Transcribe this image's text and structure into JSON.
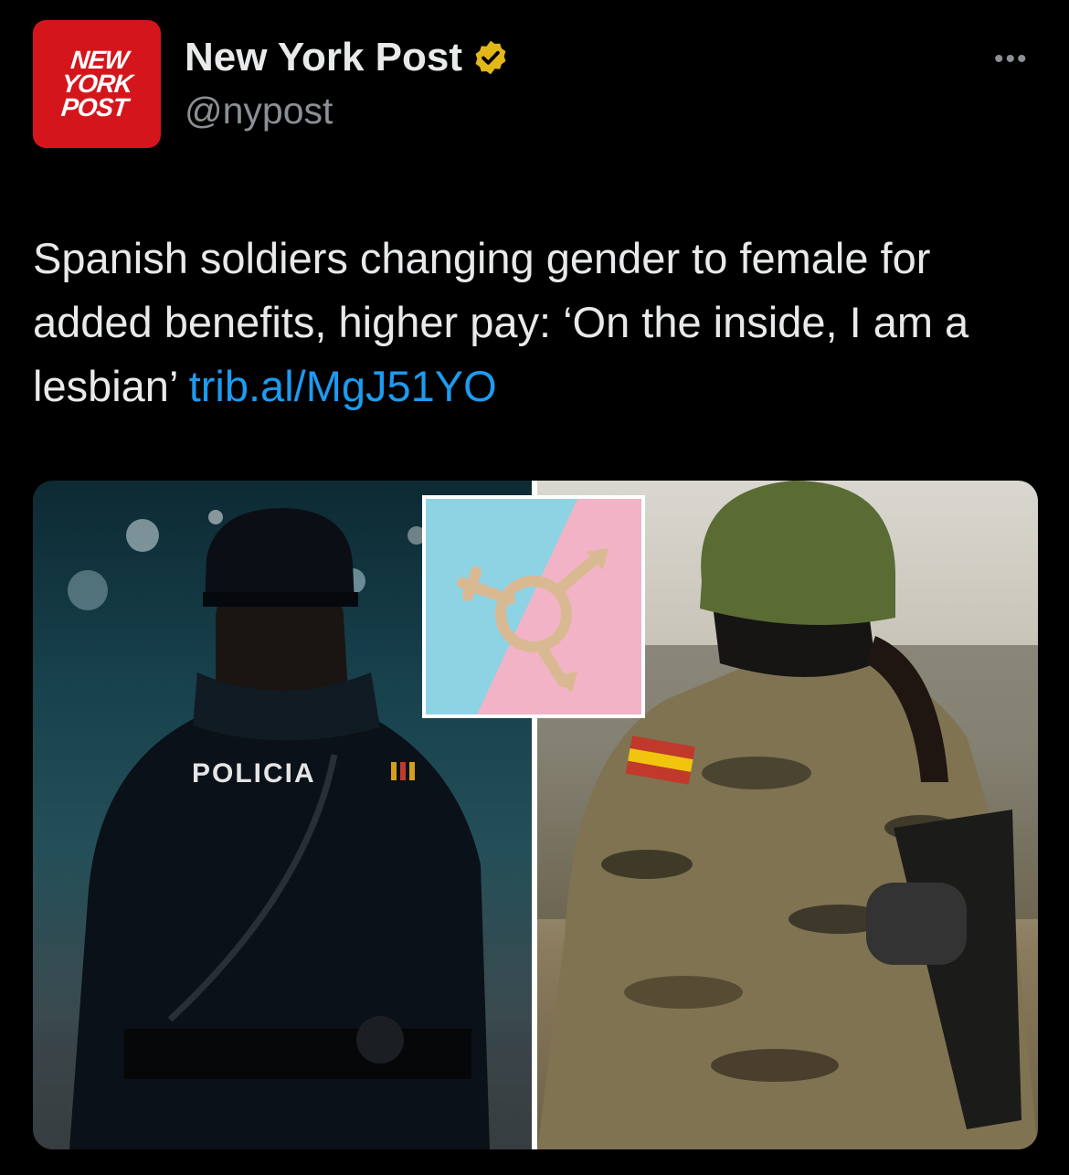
{
  "author": {
    "name": "New York Post",
    "handle": "@nypost",
    "avatar_text": [
      "NEW",
      "YORK",
      "POST"
    ],
    "verified": true,
    "verified_color": "#e2b719"
  },
  "more_icon": "more-horizontal-icon",
  "tweet": {
    "text": "Spanish soldiers changing gender to female for added benefits, higher pay: ‘On the inside, I am a lesbian’",
    "link": "trib.al/MgJ51YO",
    "link_color": "#1d9bf0"
  },
  "media": {
    "left_label": "POLICIA",
    "inset_symbol": "transgender-symbol",
    "right_flag": "spanish-flag-patch"
  },
  "colors": {
    "background": "#000000",
    "text": "#e7e9ea",
    "secondary": "#8b9095",
    "brand": "#d4161c"
  }
}
